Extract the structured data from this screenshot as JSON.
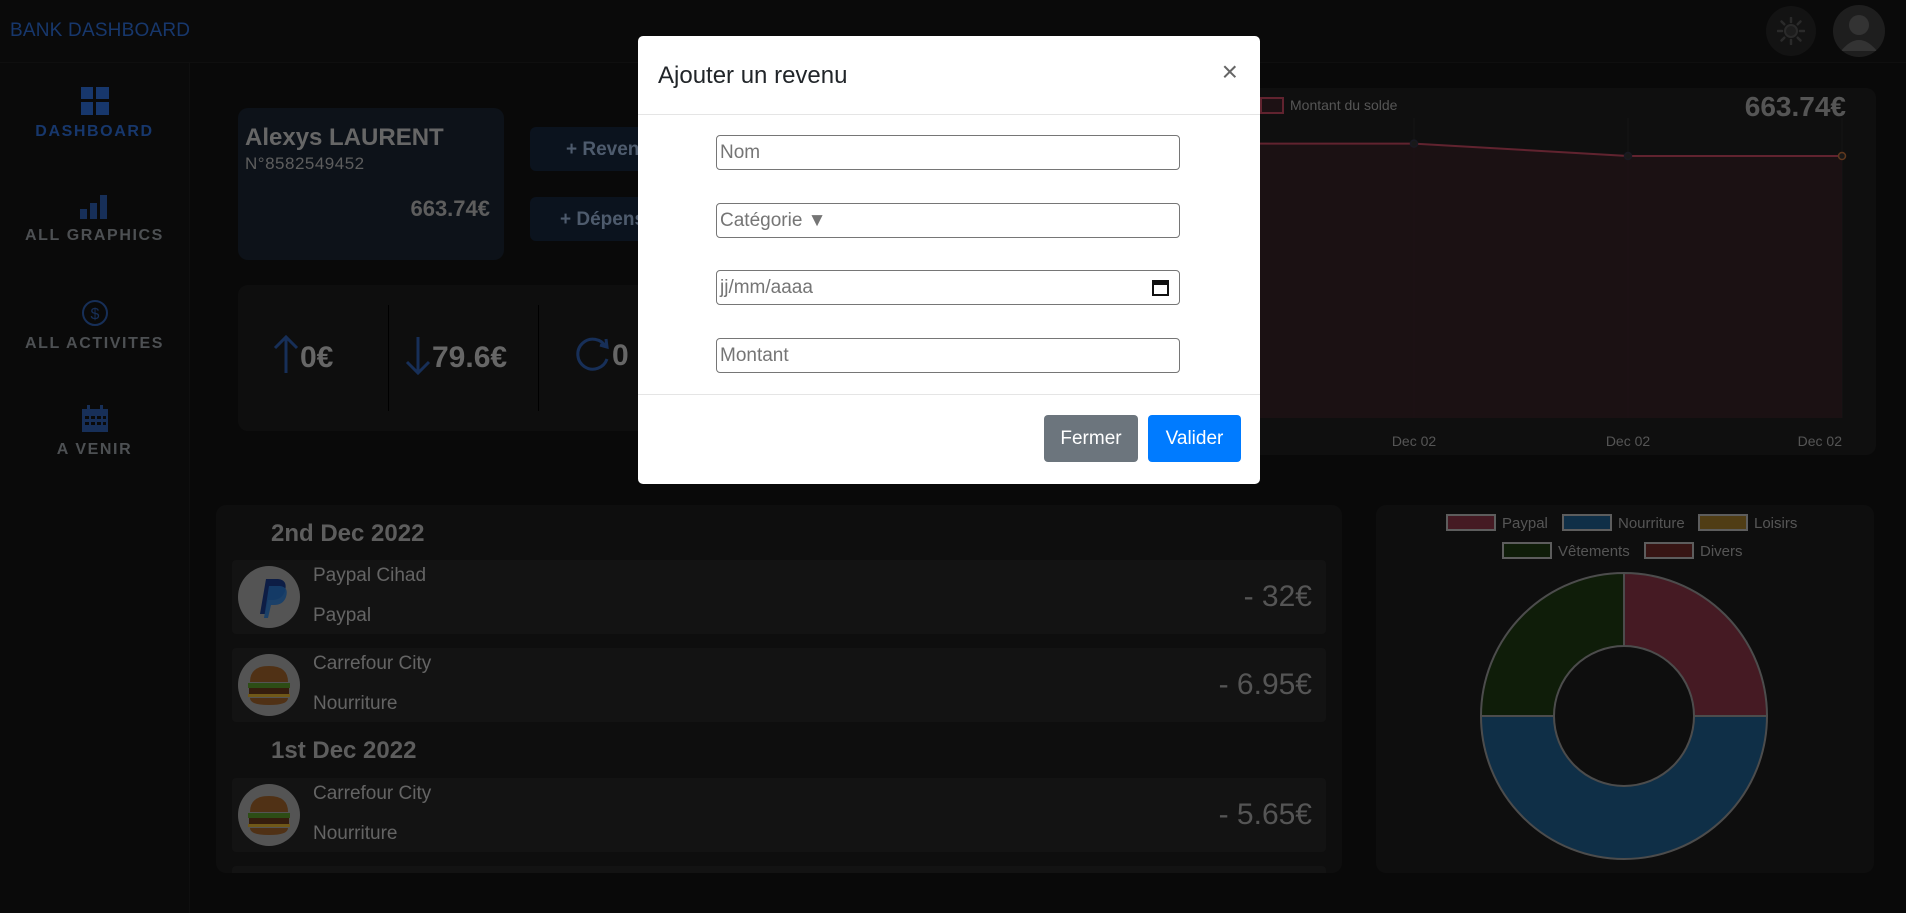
{
  "app": {
    "brand": "BANK DASHBOARD"
  },
  "sidebar": {
    "items": [
      {
        "label": "DASHBOARD",
        "icon": "dashboard-grid-icon",
        "active": true
      },
      {
        "label": "ALL GRAPHICS",
        "icon": "bar-chart-icon",
        "active": false
      },
      {
        "label": "ALL ACTIVITES",
        "icon": "dollar-circle-icon",
        "active": false
      },
      {
        "label": "A VENIR",
        "icon": "calendar-icon",
        "active": false
      }
    ]
  },
  "account": {
    "name": "Alexys LAURENT",
    "number": "N°8582549452",
    "balance": "663.74€"
  },
  "actions": {
    "income": "+ Revenu",
    "expense": "+ Dépense"
  },
  "stats": [
    {
      "value": "0€",
      "icon": "arrow-up-icon"
    },
    {
      "value": "79.6€",
      "icon": "arrow-down-icon"
    },
    {
      "value": "0",
      "icon": "refresh-icon"
    }
  ],
  "chart_data": [
    {
      "type": "area",
      "series": [
        {
          "name": "Montant du solde",
          "values": [
            695.3,
            695,
            663.74,
            663.74
          ],
          "color": "#c2475f"
        }
      ],
      "x": [
        "Dec 02",
        "Dec 02",
        "Dec 02"
      ],
      "balance_label": "663.74€"
    },
    {
      "type": "pie",
      "categories": [
        "Paypal",
        "Nourriture",
        "Loisirs",
        "Vêtements",
        "Divers"
      ],
      "values": [
        25,
        50,
        0,
        25,
        0
      ],
      "colors": [
        "#8b3446",
        "#1f5f8f",
        "#a07a2a",
        "#1f3a12",
        "#6e2b28"
      ]
    }
  ],
  "transactions": {
    "days": [
      {
        "date": "2nd Dec 2022",
        "items": [
          {
            "name": "Paypal Cihad",
            "category": "Paypal",
            "amount": "- 32€",
            "icon": "paypal-icon"
          },
          {
            "name": "Carrefour City",
            "category": "Nourriture",
            "amount": "- 6.95€",
            "icon": "burger-icon"
          }
        ]
      },
      {
        "date": "1st Dec 2022",
        "items": [
          {
            "name": "Carrefour City",
            "category": "Nourriture",
            "amount": "- 5.65€",
            "icon": "burger-icon"
          }
        ]
      }
    ]
  },
  "modal": {
    "title": "Ajouter un revenu",
    "close_symbol": "×",
    "fields": {
      "name_placeholder": "Nom",
      "category_placeholder": "Catégorie ▼",
      "date_placeholder": "jj/mm/aaaa",
      "amount_placeholder": "Montant"
    },
    "buttons": {
      "close": "Fermer",
      "submit": "Valider"
    }
  }
}
